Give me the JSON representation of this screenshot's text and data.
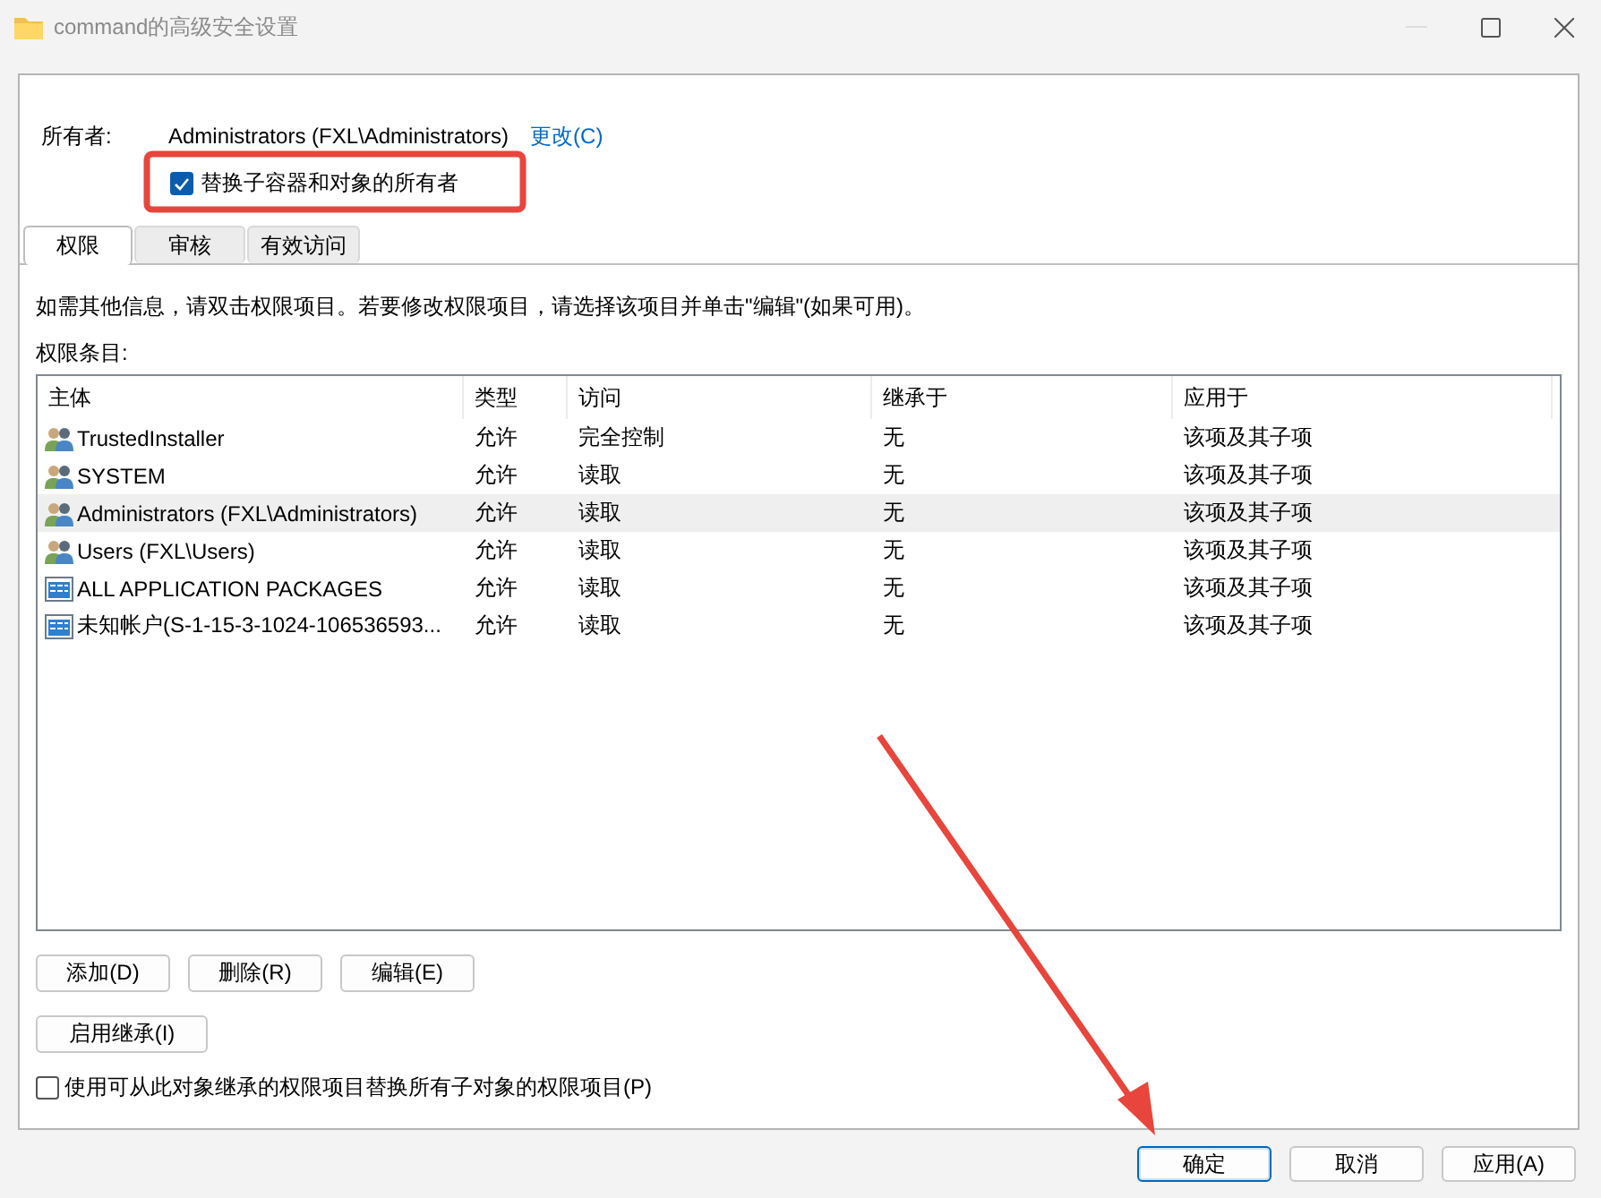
{
  "window": {
    "title": "command的高级安全设置"
  },
  "owner": {
    "label": "所有者:",
    "value": "Administrators (FXL\\Administrators)",
    "link": "更改(C)"
  },
  "replace_owner": {
    "label": "替换子容器和对象的所有者",
    "checked": true
  },
  "tabs": [
    {
      "label": "权限",
      "selected": true
    },
    {
      "label": "审核",
      "selected": false
    },
    {
      "label": "有效访问",
      "selected": false
    }
  ],
  "info_text": "如需其他信息，请双击权限项目。若要修改权限项目，请选择该项目并单击\"编辑\"(如果可用)。",
  "entries_label": "权限条目:",
  "table": {
    "columns": [
      "主体",
      "类型",
      "访问",
      "继承于",
      "应用于"
    ],
    "rows": [
      {
        "kind": "group",
        "selected": false,
        "cells": [
          "TrustedInstaller",
          "允许",
          "完全控制",
          "无",
          "该项及其子项"
        ]
      },
      {
        "kind": "group",
        "selected": false,
        "cells": [
          "SYSTEM",
          "允许",
          "读取",
          "无",
          "该项及其子项"
        ]
      },
      {
        "kind": "group",
        "selected": true,
        "cells": [
          "Administrators (FXL\\Administrators)",
          "允许",
          "读取",
          "无",
          "该项及其子项"
        ]
      },
      {
        "kind": "group",
        "selected": false,
        "cells": [
          "Users (FXL\\Users)",
          "允许",
          "读取",
          "无",
          "该项及其子项"
        ]
      },
      {
        "kind": "package",
        "selected": false,
        "cells": [
          "ALL APPLICATION PACKAGES",
          "允许",
          "读取",
          "无",
          "该项及其子项"
        ]
      },
      {
        "kind": "package",
        "selected": false,
        "cells": [
          "未知帐户(S-1-15-3-1024-106536593...",
          "允许",
          "读取",
          "无",
          "该项及其子项"
        ]
      }
    ]
  },
  "entry_buttons": [
    "添加(D)",
    "删除(R)",
    "编辑(E)"
  ],
  "inherit_button": "启用继承(I)",
  "replace_child": {
    "label": "使用可从此对象继承的权限项目替换所有子对象的权限项目(P)",
    "checked": false
  },
  "dialog_buttons": [
    {
      "label": "确定",
      "default": true
    },
    {
      "label": "取消",
      "default": false
    },
    {
      "label": "应用(A)",
      "default": false
    }
  ],
  "annotations": {
    "highlight_box": true,
    "arrow": true
  }
}
